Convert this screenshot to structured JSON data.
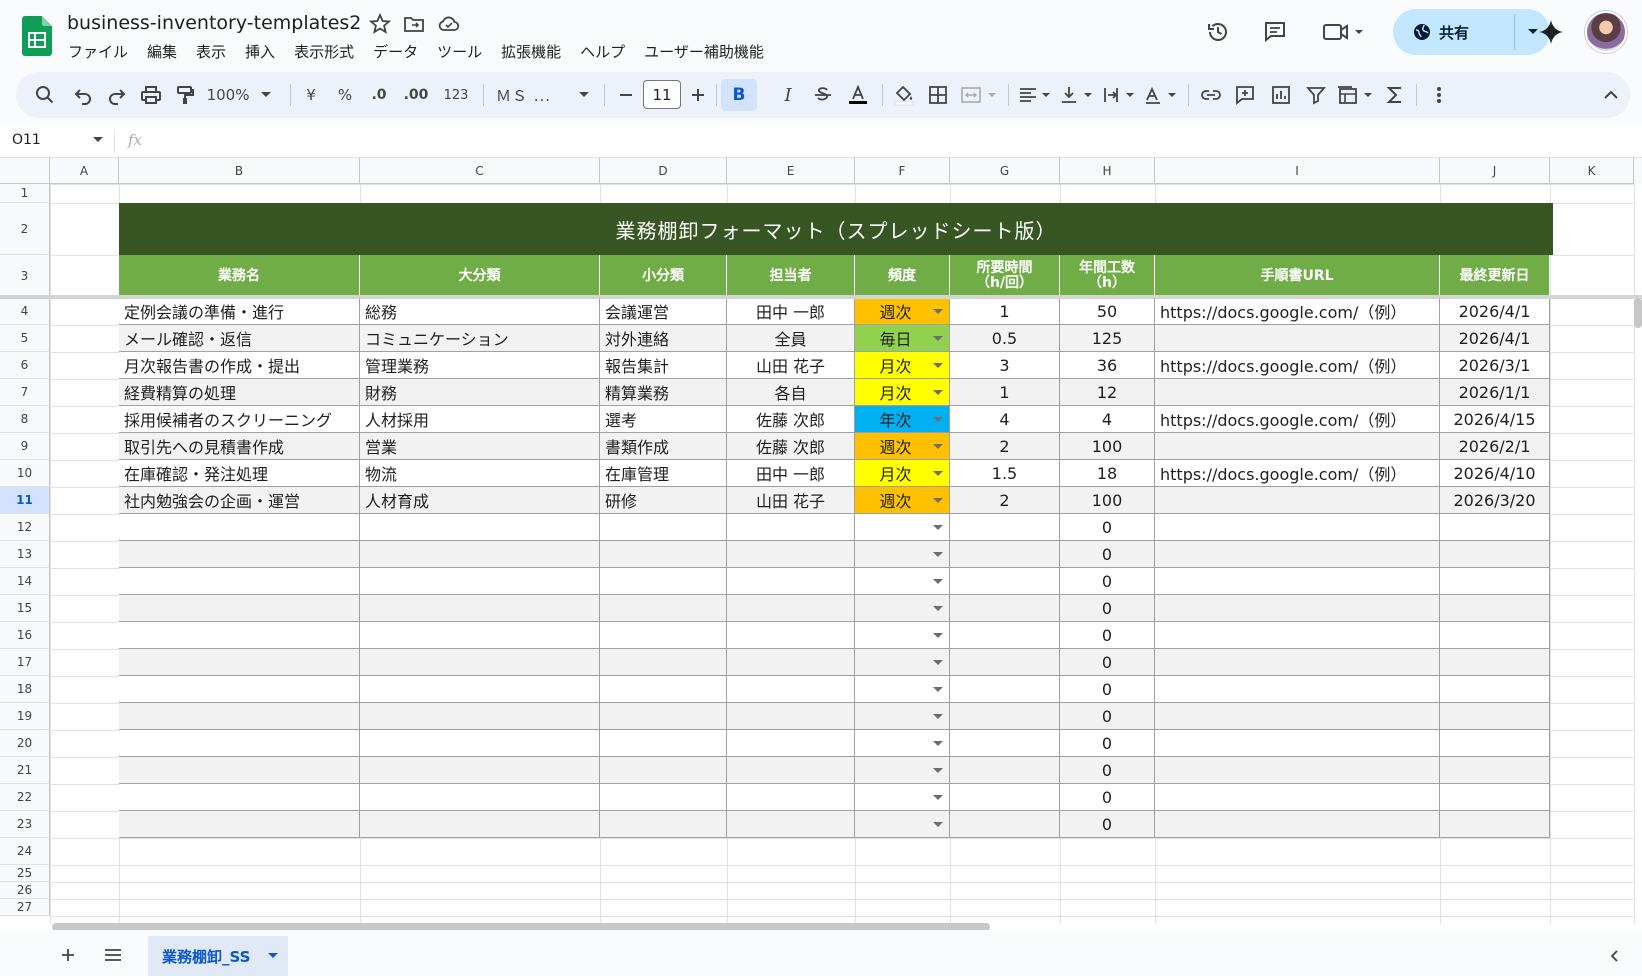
{
  "app": {
    "doc_title": "business-inventory-templates2",
    "menus": [
      "ファイル",
      "編集",
      "表示",
      "挿入",
      "表示形式",
      "データ",
      "ツール",
      "拡張機能",
      "ヘルプ",
      "ユーザー補助機能"
    ],
    "share_label": "共有"
  },
  "toolbar": {
    "zoom": "100%",
    "currency": "¥",
    "percent": "%",
    "dec_decrease": ".0",
    "dec_increase": ".00",
    "number_format": "123",
    "font": "ＭＳ ...",
    "font_size": "11",
    "bold": "B",
    "italic": "I"
  },
  "formula_bar": {
    "name_box": "O11",
    "fx": "fx"
  },
  "columns": [
    "A",
    "B",
    "C",
    "D",
    "E",
    "F",
    "G",
    "H",
    "I",
    "J",
    "K"
  ],
  "rows": [
    "1",
    "2",
    "3",
    "4",
    "5",
    "6",
    "7",
    "8",
    "9",
    "10",
    "11",
    "12",
    "13",
    "14",
    "15",
    "16",
    "17",
    "18",
    "19",
    "20",
    "21",
    "22",
    "23",
    "24",
    "25",
    "26",
    "27"
  ],
  "selected_row": "11",
  "sheet": {
    "banner": "業務棚卸フォーマット（スプレッドシート版）",
    "headers": [
      "業務名",
      "大分類",
      "小分類",
      "担当者",
      "頻度",
      "所要時間\n（h/回）",
      "年間工数\n（h）",
      "手順書URL",
      "最終更新日"
    ],
    "freq_colors": {
      "週次": "#ffc000",
      "毎日": "#92d050",
      "月次": "#ffff00",
      "年次": "#00b0f0"
    },
    "rows": [
      [
        "定例会議の準備・進行",
        "総務",
        "会議運営",
        "田中 一郎",
        "週次",
        "1",
        "50",
        "https://docs.google.com/（例）",
        "2026/4/1"
      ],
      [
        "メール確認・返信",
        "コミュニケーション",
        "対外連絡",
        "全員",
        "毎日",
        "0.5",
        "125",
        "",
        "2026/4/1"
      ],
      [
        "月次報告書の作成・提出",
        "管理業務",
        "報告集計",
        "山田 花子",
        "月次",
        "3",
        "36",
        "https://docs.google.com/（例）",
        "2026/3/1"
      ],
      [
        "経費精算の処理",
        "財務",
        "精算業務",
        "各自",
        "月次",
        "1",
        "12",
        "",
        "2026/1/1"
      ],
      [
        "採用候補者のスクリーニング",
        "人材採用",
        "選考",
        "佐藤 次郎",
        "年次",
        "4",
        "4",
        "https://docs.google.com/（例）",
        "2026/4/15"
      ],
      [
        "取引先への見積書作成",
        "営業",
        "書類作成",
        "佐藤 次郎",
        "週次",
        "2",
        "100",
        "",
        "2026/2/1"
      ],
      [
        "在庫確認・発注処理",
        "物流",
        "在庫管理",
        "田中 一郎",
        "月次",
        "1.5",
        "18",
        "https://docs.google.com/（例）",
        "2026/4/10"
      ],
      [
        "社内勉強会の企画・運営",
        "人材育成",
        "研修",
        "山田 花子",
        "週次",
        "2",
        "100",
        "",
        "2026/3/20"
      ]
    ],
    "empty_hours": [
      "0",
      "0",
      "0",
      "0",
      "0",
      "0",
      "0",
      "0",
      "0",
      "0",
      "0",
      "0"
    ]
  },
  "sheet_tab": {
    "label": "業務棚卸_SS"
  },
  "colors": {
    "banner": "#375623",
    "header": "#70ad47",
    "share": "#c2e7ff",
    "accent": "#0b57d0"
  }
}
